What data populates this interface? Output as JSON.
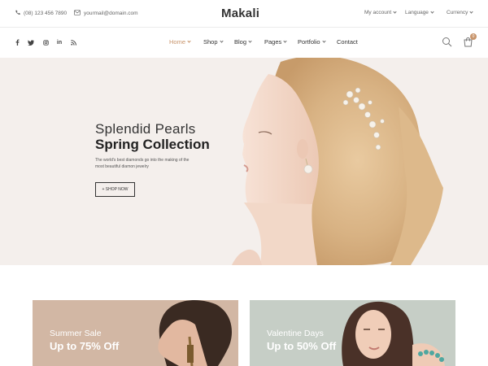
{
  "topbar": {
    "phone": "(08) 123 456 7890",
    "email": "yourmail@domain.com",
    "logo": "Makali",
    "my_account": "My account",
    "language": "Language",
    "currency": "Currency"
  },
  "social": [
    "f",
    "t",
    "ig",
    "in",
    "rss"
  ],
  "nav": {
    "items": [
      {
        "label": "Home",
        "dropdown": true,
        "active": true
      },
      {
        "label": "Shop",
        "dropdown": true
      },
      {
        "label": "Blog",
        "dropdown": true
      },
      {
        "label": "Pages",
        "dropdown": true
      },
      {
        "label": "Portfolio",
        "dropdown": true
      },
      {
        "label": "Contact",
        "dropdown": false
      }
    ],
    "cart_count": "0"
  },
  "hero": {
    "title_line1": "Splendid Pearls",
    "title_line2": "Spring Collection",
    "description": "The world's best diamonds go into the making of the most beautiful diamon jewelry",
    "button": "+ SHOP NOW"
  },
  "banners": [
    {
      "kicker": "Summer Sale",
      "headline": "Up to 75% Off"
    },
    {
      "kicker": "Valentine Days",
      "headline": "Up to 50% Off"
    }
  ],
  "colors": {
    "accent": "#c8956c",
    "hero_bg": "#f4efec",
    "banner_left_bg": "#d2b7a4",
    "banner_right_bg": "#c6cec6"
  }
}
